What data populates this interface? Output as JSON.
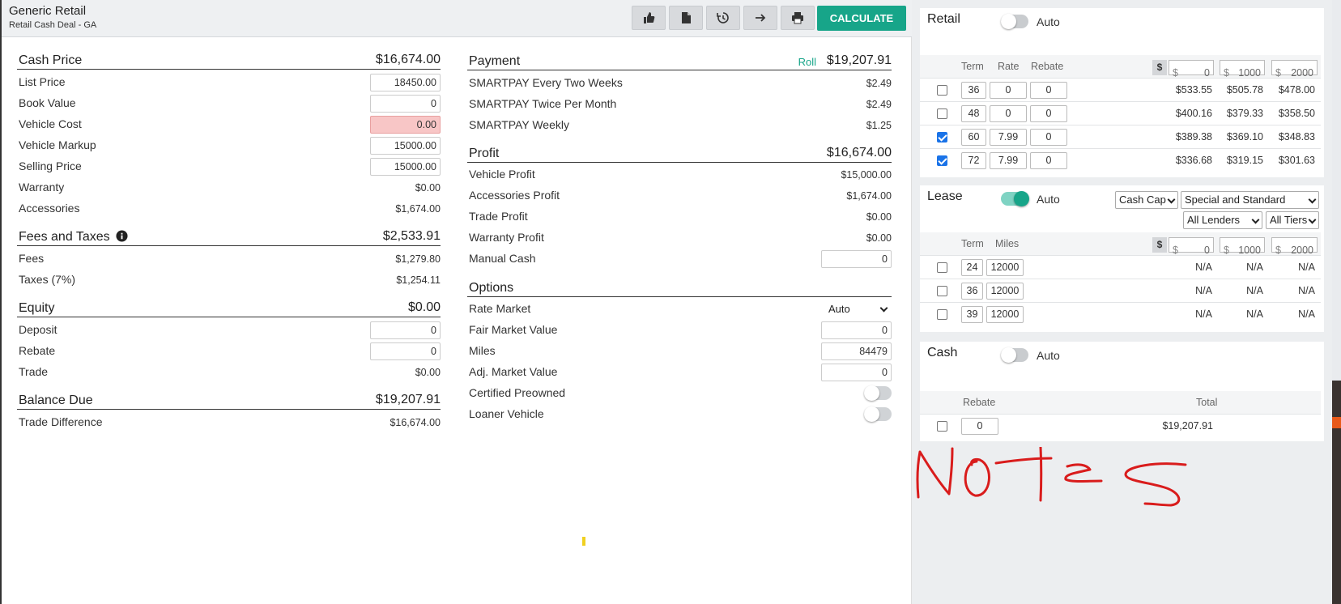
{
  "header": {
    "title": "Generic Retail",
    "subtitle": "Retail Cash Deal - GA",
    "calculate_label": "CALCULATE",
    "icons": [
      "thumbs-up-icon",
      "document-icon",
      "history-icon",
      "arrow-right-icon",
      "print-icon"
    ]
  },
  "cash_price": {
    "label": "Cash Price",
    "total": "$16,674.00",
    "list_price_label": "List Price",
    "list_price": "18450.00",
    "book_value_label": "Book Value",
    "book_value": "0",
    "vehicle_cost_label": "Vehicle Cost",
    "vehicle_cost": "0.00",
    "vehicle_markup_label": "Vehicle Markup",
    "vehicle_markup": "15000.00",
    "selling_price_label": "Selling Price",
    "selling_price": "15000.00",
    "warranty_label": "Warranty",
    "warranty": "$0.00",
    "accessories_label": "Accessories",
    "accessories": "$1,674.00"
  },
  "fees_taxes": {
    "label": "Fees and Taxes",
    "total": "$2,533.91",
    "fees_label": "Fees",
    "fees": "$1,279.80",
    "taxes_label": "Taxes (7%)",
    "taxes": "$1,254.11"
  },
  "equity": {
    "label": "Equity",
    "total": "$0.00",
    "deposit_label": "Deposit",
    "deposit": "0",
    "rebate_label": "Rebate",
    "rebate": "0",
    "trade_label": "Trade",
    "trade": "$0.00"
  },
  "balance": {
    "label": "Balance Due",
    "total": "$19,207.91",
    "trade_diff_label": "Trade Difference",
    "trade_diff": "$16,674.00"
  },
  "payment": {
    "label": "Payment",
    "roll_label": "Roll",
    "total": "$19,207.91",
    "items": [
      {
        "label": "SMARTPAY Every Two Weeks",
        "value": "$2.49"
      },
      {
        "label": "SMARTPAY Twice Per Month",
        "value": "$2.49"
      },
      {
        "label": "SMARTPAY Weekly",
        "value": "$1.25"
      }
    ]
  },
  "profit": {
    "label": "Profit",
    "total": "$16,674.00",
    "vehicle_label": "Vehicle Profit",
    "vehicle": "$15,000.00",
    "accessories_label": "Accessories Profit",
    "accessories": "$1,674.00",
    "trade_label": "Trade Profit",
    "trade": "$0.00",
    "warranty_label": "Warranty Profit",
    "warranty": "$0.00",
    "manual_cash_label": "Manual Cash",
    "manual_cash": "0"
  },
  "options": {
    "label": "Options",
    "rate_market_label": "Rate Market",
    "rate_market": "Auto",
    "fmv_label": "Fair Market Value",
    "fmv": "0",
    "miles_label": "Miles",
    "miles": "84479",
    "adj_mv_label": "Adj. Market Value",
    "adj_mv": "0",
    "cpo_label": "Certified Preowned",
    "cpo_on": false,
    "loaner_label": "Loaner Vehicle",
    "loaner_on": false
  },
  "retail": {
    "title": "Retail",
    "auto_label": "Auto",
    "auto_on": false,
    "headers": {
      "term": "Term",
      "rate": "Rate",
      "rebate": "Rebate"
    },
    "dollar": "$",
    "prefix": "$",
    "down": [
      "0",
      "1000",
      "2000"
    ],
    "rows": [
      {
        "checked": false,
        "term": "36",
        "rate": "0",
        "rebate": "0",
        "values": [
          "$533.55",
          "$505.78",
          "$478.00"
        ]
      },
      {
        "checked": false,
        "term": "48",
        "rate": "0",
        "rebate": "0",
        "values": [
          "$400.16",
          "$379.33",
          "$358.50"
        ]
      },
      {
        "checked": true,
        "term": "60",
        "rate": "7.99",
        "rebate": "0",
        "values": [
          "$389.38",
          "$369.10",
          "$348.83"
        ]
      },
      {
        "checked": true,
        "term": "72",
        "rate": "7.99",
        "rebate": "0",
        "values": [
          "$336.68",
          "$319.15",
          "$301.63"
        ]
      }
    ]
  },
  "lease": {
    "title": "Lease",
    "auto_label": "Auto",
    "auto_on": true,
    "select_cap": "Cash Cap",
    "select_program": "Special and Standard",
    "select_lenders": "All Lenders",
    "select_tiers": "All Tiers",
    "headers": {
      "term": "Term",
      "miles": "Miles"
    },
    "dollar": "$",
    "prefix": "$",
    "down": [
      "0",
      "1000",
      "2000"
    ],
    "rows": [
      {
        "checked": false,
        "term": "24",
        "miles": "12000",
        "values": [
          "N/A",
          "N/A",
          "N/A"
        ]
      },
      {
        "checked": false,
        "term": "36",
        "miles": "12000",
        "values": [
          "N/A",
          "N/A",
          "N/A"
        ]
      },
      {
        "checked": false,
        "term": "39",
        "miles": "12000",
        "values": [
          "N/A",
          "N/A",
          "N/A"
        ]
      }
    ]
  },
  "cash": {
    "title": "Cash",
    "auto_label": "Auto",
    "auto_on": false,
    "headers": {
      "rebate": "Rebate",
      "total": "Total"
    },
    "row": {
      "checked": false,
      "rebate": "0",
      "total": "$19,207.91"
    }
  },
  "notes_scribble": "Notes",
  "colors": {
    "accent": "#17a589",
    "error_bg": "#f8c6c6",
    "scribble": "#d91c1c",
    "checkbox": "#1a73e8"
  }
}
